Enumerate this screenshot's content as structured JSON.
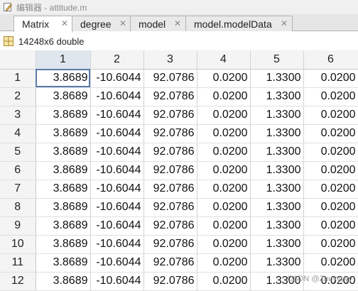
{
  "window": {
    "title": "编辑器 - attitude.m"
  },
  "tabs": [
    {
      "label": "Matrix",
      "active": true
    },
    {
      "label": "degree",
      "active": false
    },
    {
      "label": "model",
      "active": false
    },
    {
      "label": "model.modelData",
      "active": false
    }
  ],
  "close_glyph": "✕",
  "variable": {
    "icon": "grid-icon",
    "size_text": "14248x6 double"
  },
  "columns": [
    "1",
    "2",
    "3",
    "4",
    "5",
    "6"
  ],
  "rows": [
    {
      "index": "1",
      "cells": [
        "3.8689",
        "-10.6044",
        "92.0786",
        "0.0200",
        "1.3300",
        "0.0200"
      ]
    },
    {
      "index": "2",
      "cells": [
        "3.8689",
        "-10.6044",
        "92.0786",
        "0.0200",
        "1.3300",
        "0.0200"
      ]
    },
    {
      "index": "3",
      "cells": [
        "3.8689",
        "-10.6044",
        "92.0786",
        "0.0200",
        "1.3300",
        "0.0200"
      ]
    },
    {
      "index": "4",
      "cells": [
        "3.8689",
        "-10.6044",
        "92.0786",
        "0.0200",
        "1.3300",
        "0.0200"
      ]
    },
    {
      "index": "5",
      "cells": [
        "3.8689",
        "-10.6044",
        "92.0786",
        "0.0200",
        "1.3300",
        "0.0200"
      ]
    },
    {
      "index": "6",
      "cells": [
        "3.8689",
        "-10.6044",
        "92.0786",
        "0.0200",
        "1.3300",
        "0.0200"
      ]
    },
    {
      "index": "7",
      "cells": [
        "3.8689",
        "-10.6044",
        "92.0786",
        "0.0200",
        "1.3300",
        "0.0200"
      ]
    },
    {
      "index": "8",
      "cells": [
        "3.8689",
        "-10.6044",
        "92.0786",
        "0.0200",
        "1.3300",
        "0.0200"
      ]
    },
    {
      "index": "9",
      "cells": [
        "3.8689",
        "-10.6044",
        "92.0786",
        "0.0200",
        "1.3300",
        "0.0200"
      ]
    },
    {
      "index": "10",
      "cells": [
        "3.8689",
        "-10.6044",
        "92.0786",
        "0.0200",
        "1.3300",
        "0.0200"
      ]
    },
    {
      "index": "11",
      "cells": [
        "3.8689",
        "-10.6044",
        "92.0786",
        "0.0200",
        "1.3300",
        "0.0200"
      ]
    },
    {
      "index": "12",
      "cells": [
        "3.8689",
        "-10.6044",
        "92.0786",
        "0.0200",
        "1.3300",
        "0.0200"
      ]
    }
  ],
  "watermark": "CSDN @Zhuyyyyy",
  "colors": {
    "selection_outline": "#5a7aa8",
    "header_bg": "#f4f4f4",
    "selected_header_bg": "#dfe6ee"
  }
}
